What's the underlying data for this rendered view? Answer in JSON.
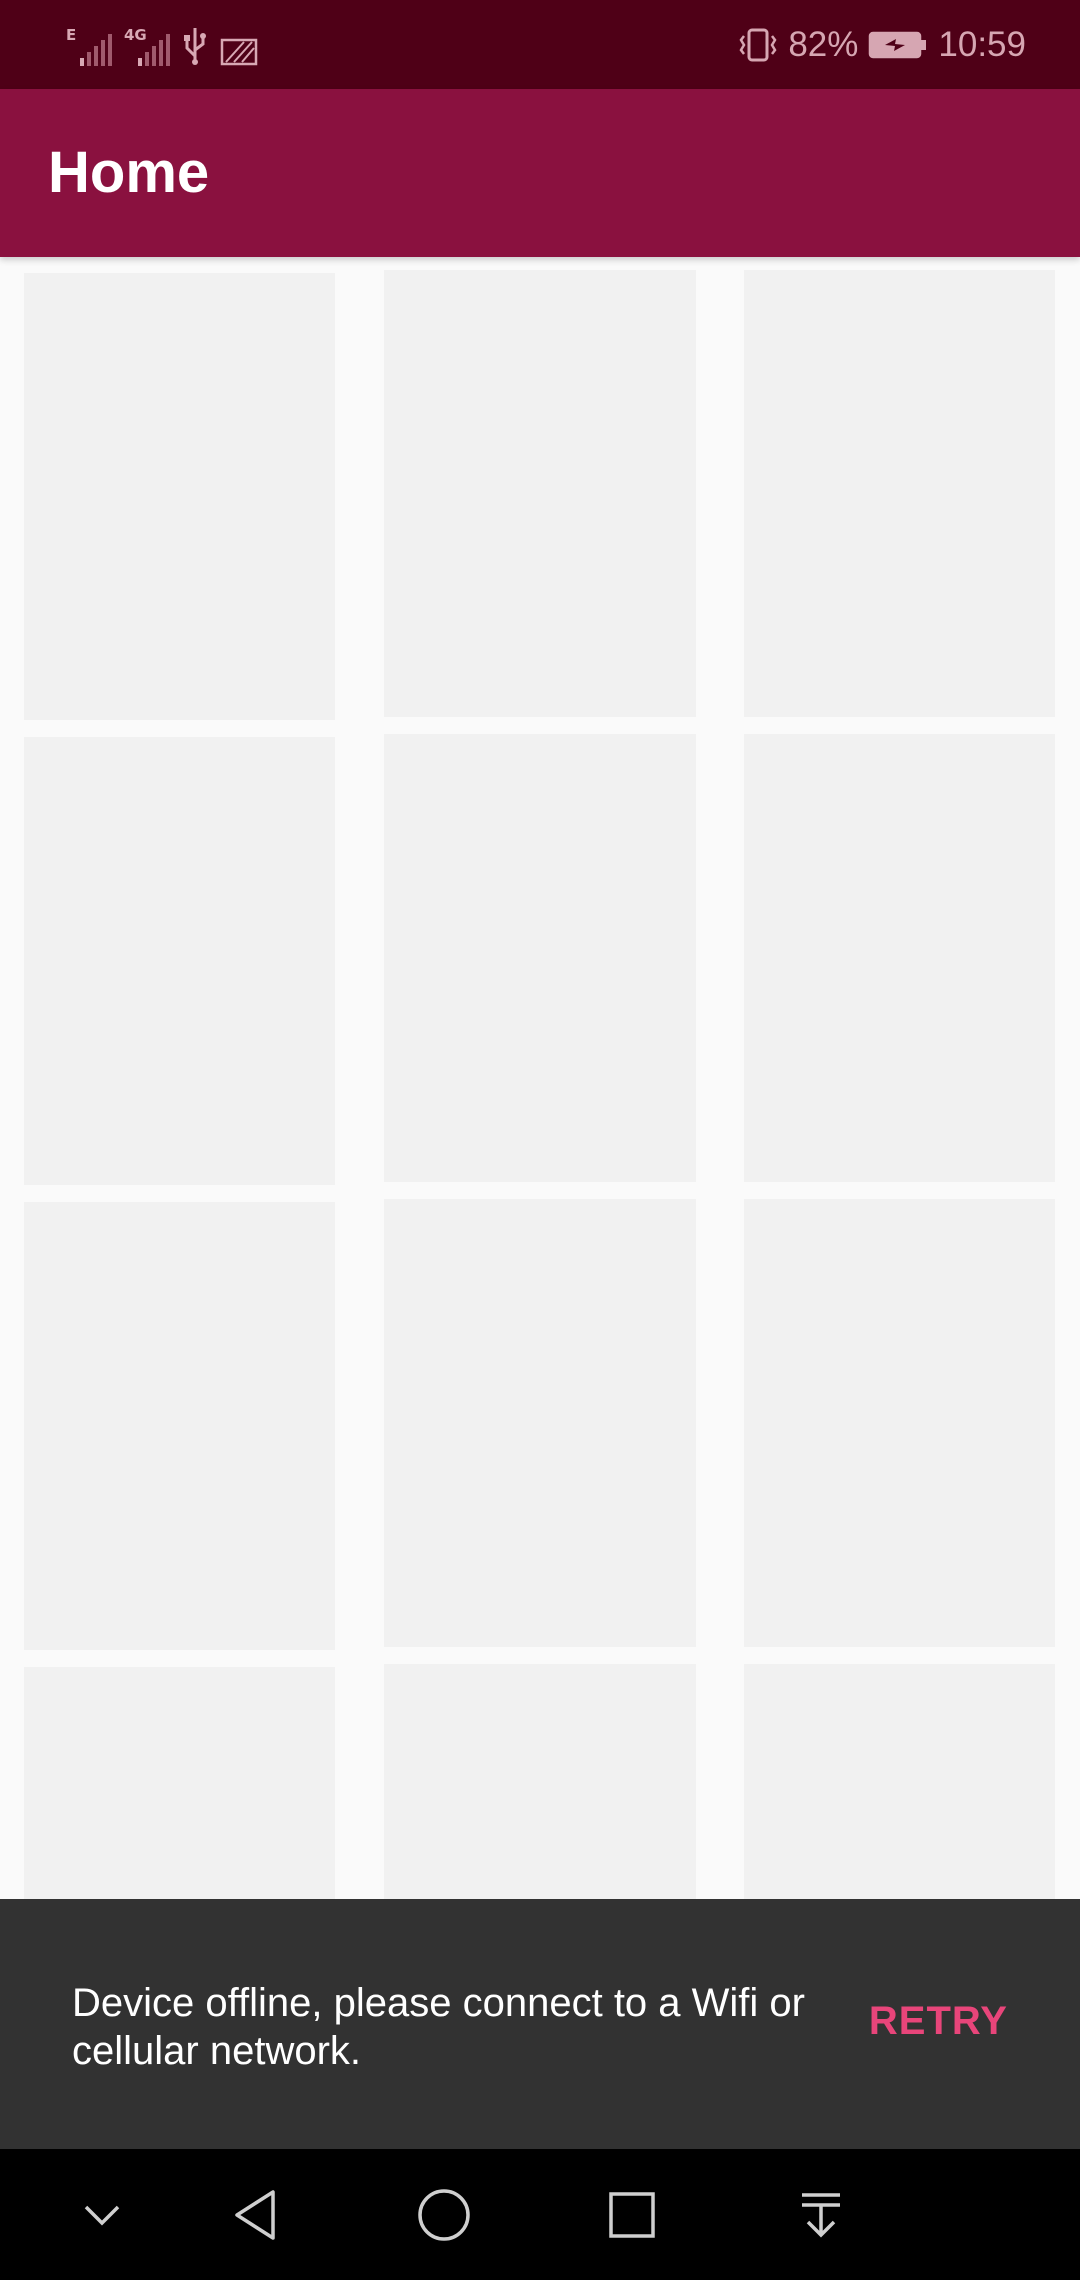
{
  "status_bar": {
    "network_1": "E",
    "network_2": "4G",
    "battery_percent": "82%",
    "time": "10:59",
    "icons": [
      "signal-icon",
      "usb-icon",
      "no-sim-icon",
      "vibrate-icon",
      "battery-charging-icon"
    ]
  },
  "app_bar": {
    "title": "Home"
  },
  "snackbar": {
    "message": "Device offline, please connect to a Wifi or cellular network.",
    "action_label": "RETRY"
  },
  "nav_bar": {
    "icons": [
      "hide-nav-icon",
      "back-icon",
      "home-icon",
      "recents-icon",
      "notification-pull-icon"
    ]
  },
  "colors": {
    "status_bar": "#4f0017",
    "app_bar": "#8a113f",
    "placeholder_tile": "#f1f1f1",
    "snackbar_bg": "#323232",
    "snackbar_action": "#e8457a"
  }
}
